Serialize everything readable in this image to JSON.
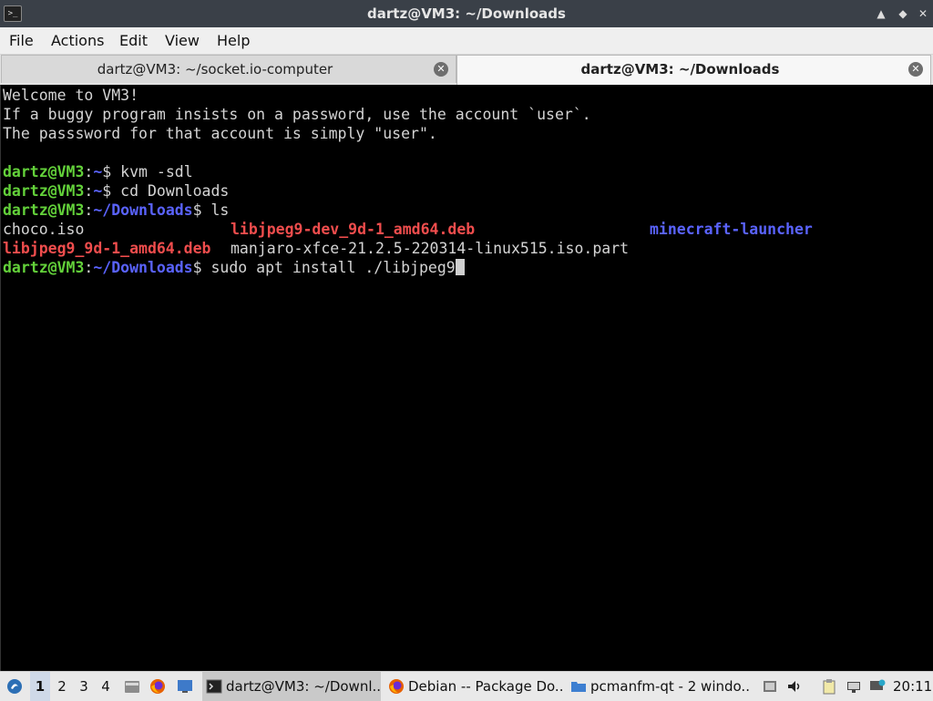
{
  "window": {
    "title": "dartz@VM3: ~/Downloads",
    "minimize_glyph": "▲",
    "maximize_glyph": "◆",
    "close_glyph": "✕",
    "app_icon_glyph": ">_"
  },
  "menu": [
    "File",
    "Actions",
    "Edit",
    "View",
    "Help"
  ],
  "tabs": [
    {
      "label": "dartz@VM3: ~/socket.io-computer",
      "active": false
    },
    {
      "label": "dartz@VM3: ~/Downloads",
      "active": true
    }
  ],
  "terminal": {
    "motd": [
      "Welcome to VM3!",
      "If a buggy program insists on a password, use the account `user`.",
      "The passsword for that account is simply \"user\"."
    ],
    "user_host": "dartz@VM3",
    "home_path": "~",
    "downloads_path": "~/Downloads",
    "commands": [
      "kvm -sdl",
      "cd Downloads",
      "ls",
      "sudo apt install ./libjpeg9"
    ],
    "ls_output": {
      "row1": [
        "choco.iso",
        "libjpeg9-dev_9d-1_amd64.deb",
        "minecraft-launcher"
      ],
      "row2": [
        "libjpeg9_9d-1_amd64.deb",
        "manjaro-xfce-21.2.5-220314-linux515.iso.part"
      ]
    },
    "colors": {
      "prompt_user": "#63d13a",
      "prompt_path": "#5a63ff",
      "deb_file": "#f04d4d",
      "directory": "#5a63ff"
    }
  },
  "taskbar": {
    "desktops": [
      "1",
      "2",
      "3",
      "4"
    ],
    "current_desktop": "1",
    "tasks": [
      {
        "label": "dartz@VM3: ~/Downl...",
        "icon": "terminal-icon",
        "active": true
      },
      {
        "label": "Debian -- Package Do...",
        "icon": "firefox-icon",
        "active": false
      },
      {
        "label": "pcmanfm-qt - 2 windo...",
        "icon": "folder-icon",
        "active": false
      }
    ],
    "clock": "20:11"
  }
}
